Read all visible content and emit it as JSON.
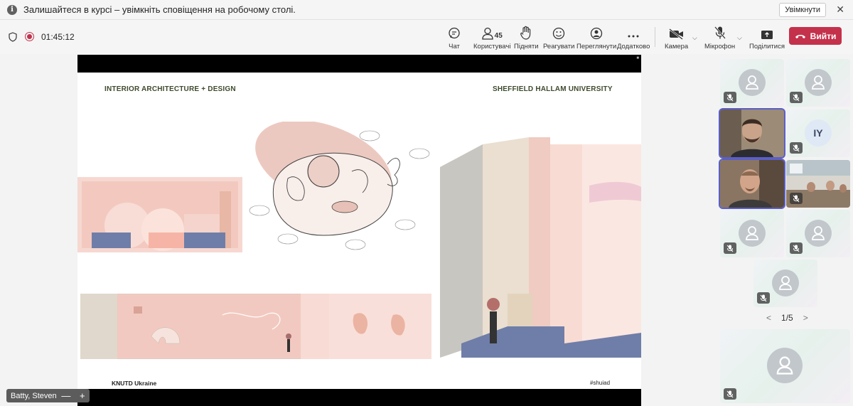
{
  "notification": {
    "message": "Залишайтеся в курсі – увімкніть сповіщення на робочому столі.",
    "enable_label": "Увімкнути",
    "close_glyph": "✕"
  },
  "meeting": {
    "timer": "01:45:12",
    "participant_count": "45"
  },
  "toolbar": {
    "chat": "Чат",
    "people": "Користувачі",
    "raise": "Підняти",
    "react": "Реагувати",
    "view": "Переглянути",
    "more": "Додатково",
    "camera": "Камера",
    "mic": "Мікрофон",
    "share": "Поділитися",
    "leave": "Вийти"
  },
  "slide": {
    "title_left": "INTERIOR ARCHITECTURE + DESIGN",
    "title_right": "SHEFFIELD HALLAM UNIVERSITY",
    "footer_left": "KNUTD Ukraine",
    "footer_right": "#shuiad"
  },
  "participants": {
    "initials_tile": "IY",
    "page": "1/5"
  },
  "presenter": {
    "name": "Batty, Steven",
    "zoom_out": "—",
    "zoom_in": "+"
  },
  "colors": {
    "accent": "#5b5fc7",
    "leave": "#c4314b",
    "slide_blush": "#f2c6bd",
    "slide_blue": "#6f7ea8"
  }
}
